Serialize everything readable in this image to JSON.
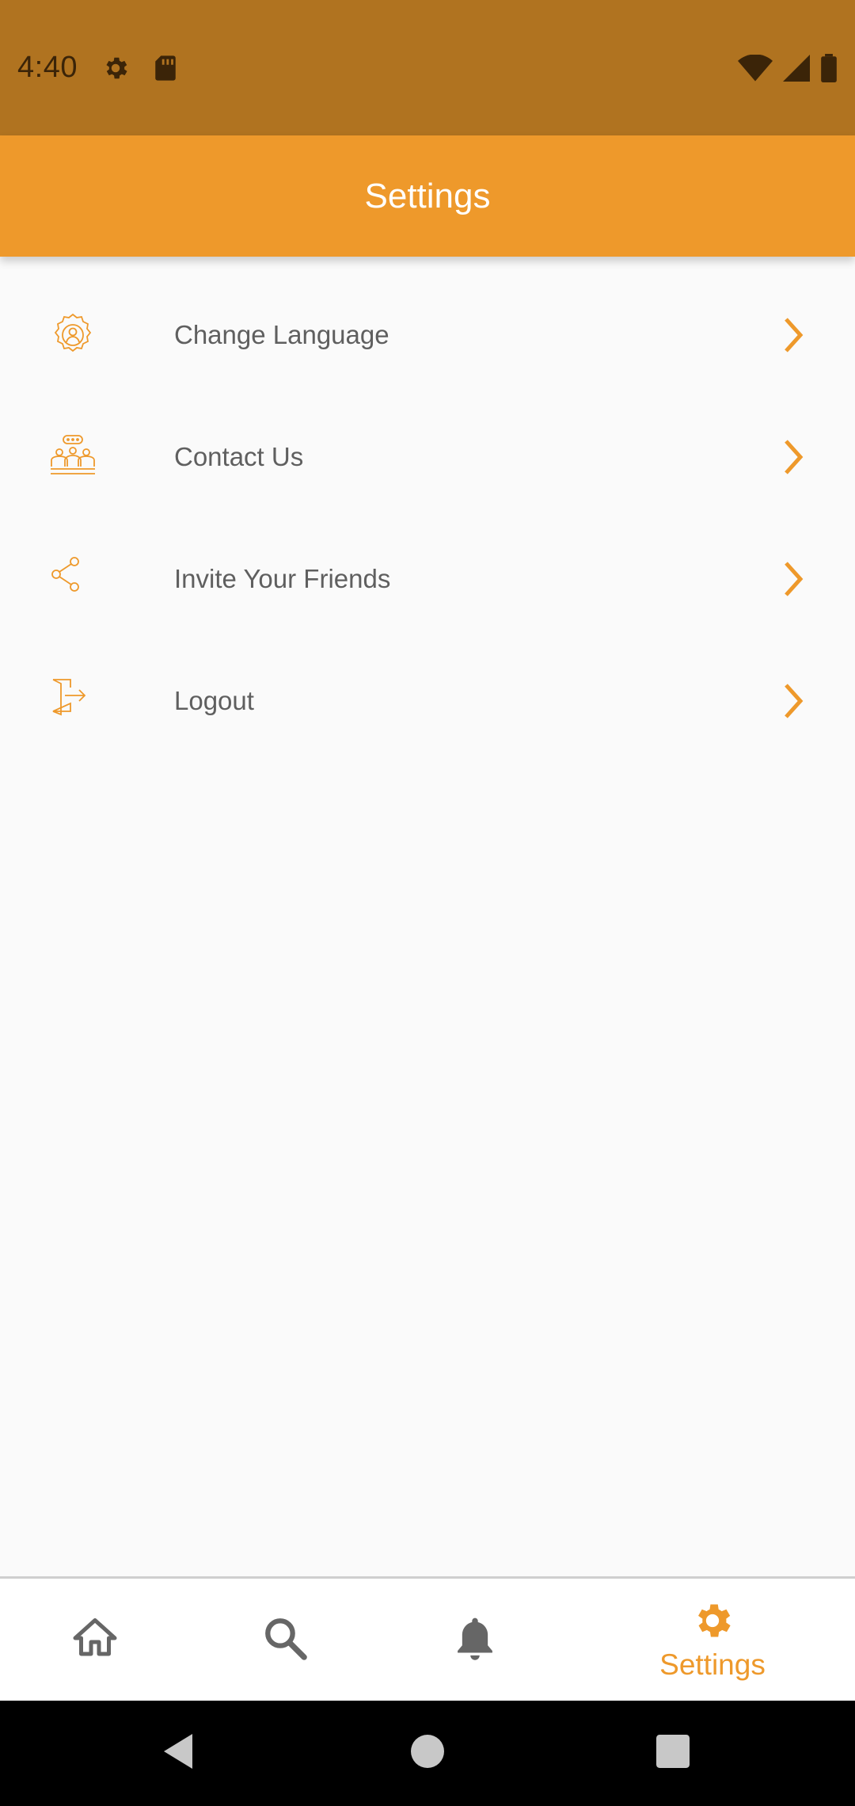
{
  "status_bar": {
    "time": "4:40",
    "icons_left": [
      "gear-icon",
      "sd-card-icon"
    ],
    "icons_right": [
      "wifi-icon",
      "signal-icon",
      "battery-icon"
    ]
  },
  "app_bar": {
    "title": "Settings"
  },
  "settings": {
    "items": [
      {
        "label": "Change Language",
        "icon": "language-gear-icon"
      },
      {
        "label": "Contact Us",
        "icon": "contact-group-icon"
      },
      {
        "label": "Invite Your Friends",
        "icon": "share-icon"
      },
      {
        "label": "Logout",
        "icon": "logout-icon"
      }
    ]
  },
  "bottom_nav": {
    "items": [
      {
        "icon": "home-icon",
        "label": "",
        "active": false
      },
      {
        "icon": "search-icon",
        "label": "",
        "active": false
      },
      {
        "icon": "bell-icon",
        "label": "",
        "active": false
      },
      {
        "icon": "gear-icon",
        "label": "Settings",
        "active": true
      }
    ]
  },
  "colors": {
    "accent": "#ee992b",
    "status_bar": "#b07320",
    "inactive_icon": "#666666",
    "text": "#5f5f5f"
  }
}
